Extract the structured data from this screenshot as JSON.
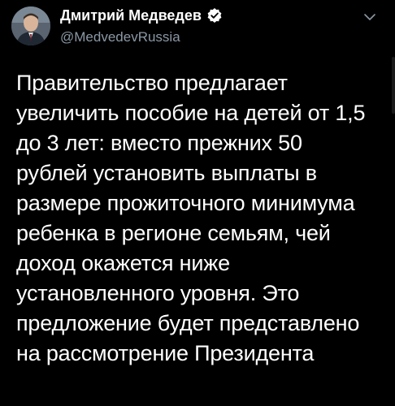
{
  "account": {
    "display_name": "Дмитрий Медведев",
    "handle": "@MedvedevRussia",
    "verified": true
  },
  "icons": {
    "verified": "verified-badge-icon",
    "menu": "chevron-down-icon"
  },
  "tweet": {
    "text": "Правительство предлагает\nувеличить пособие на детей от 1,5\nдо 3 лет: вместо прежних 50\nрублей установить выплаты в\nразмере прожиточного минимума\nребенка в регионе семьям, чей\nдоход окажется ниже\nустановленного уровня. Это\nпредложение будет представлено\nна рассмотрение Президента"
  },
  "colors": {
    "background": "#000000",
    "text": "#ffffff",
    "secondary_text": "#8b98a5"
  }
}
